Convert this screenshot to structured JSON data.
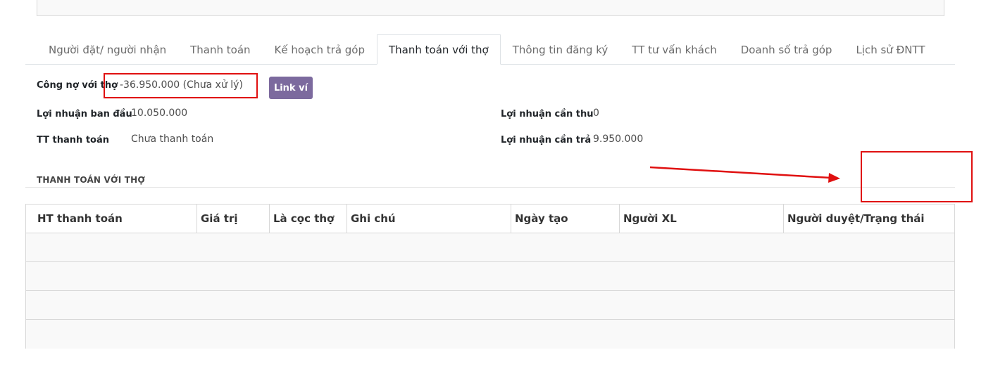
{
  "tabs": [
    {
      "label": "Người đặt/ người nhận"
    },
    {
      "label": "Thanh toán"
    },
    {
      "label": "Kế hoạch trả góp"
    },
    {
      "label": "Thanh toán với thợ",
      "active": true
    },
    {
      "label": "Thông tin đăng ký"
    },
    {
      "label": "TT tư vấn khách"
    },
    {
      "label": "Doanh số trả góp"
    },
    {
      "label": "Lịch sử ĐNTT"
    }
  ],
  "form": {
    "debt_label": "Công nợ với thợ",
    "debt_value": "-36.950.000 (Chưa xử lý)",
    "link_button": "Link ví",
    "initial_profit_label": "Lợi nhuận ban đầu",
    "initial_profit_value": "10.050.000",
    "payment_status_label": "TT thanh toán",
    "payment_status_value": "Chưa thanh toán",
    "profit_receivable_label": "Lợi nhuận cần thu",
    "profit_receivable_value": "0",
    "profit_payable_label": "Lợi nhuận cần trả",
    "profit_payable_value": "9.950.000"
  },
  "section": {
    "title": "THANH TOÁN VỚI THỢ"
  },
  "table": {
    "columns": [
      "HT thanh toán",
      "Giá trị",
      "Là cọc thợ",
      "Ghi chú",
      "Ngày tạo",
      "Người XL",
      "Người duyệt/Trạng thái"
    ],
    "rows": 4
  },
  "annotations": {
    "color": "#e01010"
  }
}
